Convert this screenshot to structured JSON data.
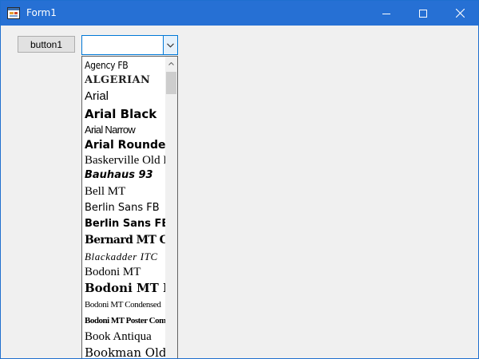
{
  "window": {
    "title": "Form1",
    "icon": "form-app-icon",
    "controls": [
      "minimize-icon",
      "maximize-icon",
      "close-icon"
    ]
  },
  "button1": {
    "label": "button1"
  },
  "combo": {
    "value": ""
  },
  "font_list": {
    "items": [
      "Agency FB",
      "ALGERIAN",
      "Arial",
      "Arial Black",
      "Arial Narrow",
      "Arial Rounded MT Bold",
      "Baskerville Old Face",
      "Bauhaus 93",
      "Bell MT",
      "Berlin Sans FB",
      "Berlin Sans FB Demi",
      "Bernard MT Condensed",
      "Blackadder ITC",
      "Bodoni MT",
      "Bodoni MT Black",
      "Bodoni MT Condensed",
      "Bodoni MT Poster Compressed",
      "Book Antiqua",
      "Bookman Old Style"
    ]
  },
  "colors": {
    "titlebar": "#2670d4",
    "focus_border": "#0078d7",
    "client": "#f0f0f0"
  }
}
